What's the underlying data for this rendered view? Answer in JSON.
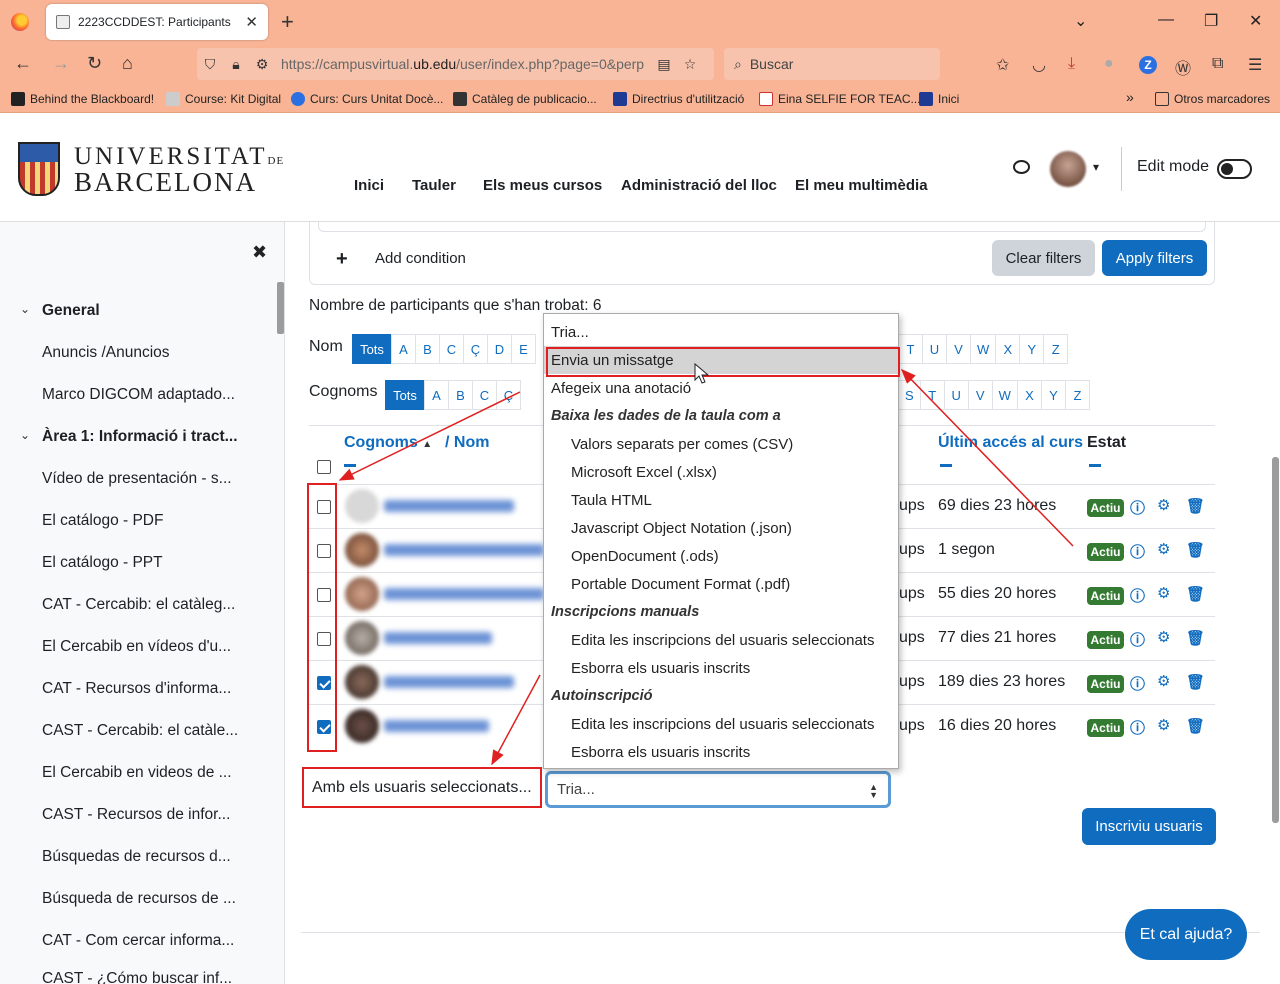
{
  "browser": {
    "tab_title": "2223CCDDEST: Participants",
    "url_prefix": "https://campusvirtual.",
    "url_domain": "ub.edu",
    "url_suffix": "/user/index.php?page=0&perp",
    "search_placeholder": "Buscar",
    "bookmarks": [
      "Behind the Blackboard!",
      "Course: Kit Digital",
      "Curs: Curs Unitat Docè...",
      "Catàleg de publicacio...",
      "Directrius d'utilització",
      "Eina SELFIE FOR TEAC...",
      "Inici"
    ],
    "other_bookmarks": "Otros marcadores"
  },
  "header": {
    "logo_line1": "UNIVERSITAT",
    "logo_de": "DE",
    "logo_line2": "BARCELONA",
    "nav": [
      "Inici",
      "Tauler",
      "Els meus cursos",
      "Administració del lloc",
      "El meu multimèdia"
    ],
    "edit_mode": "Edit mode"
  },
  "sidebar": {
    "items": [
      {
        "label": "General",
        "bold": true
      },
      {
        "label": "Anuncis /Anuncios"
      },
      {
        "label": "Marco DIGCOM adaptado..."
      },
      {
        "label": "Àrea 1: Informació i tract...",
        "bold": true
      },
      {
        "label": "Vídeo de presentación - s..."
      },
      {
        "label": "El catálogo - PDF"
      },
      {
        "label": "El catálogo - PPT"
      },
      {
        "label": "CAT - Cercabib: el catàleg..."
      },
      {
        "label": "El Cercabib en vídeos d'u..."
      },
      {
        "label": "CAT - Recursos d'informa..."
      },
      {
        "label": "CAST - Cercabib: el catàle..."
      },
      {
        "label": "El Cercabib en videos de ..."
      },
      {
        "label": "CAST - Recursos de infor..."
      },
      {
        "label": "Búsquedas de recursos d..."
      },
      {
        "label": "Búsqueda de recursos de ..."
      },
      {
        "label": "CAT - Com cercar informa..."
      },
      {
        "label": "CAST - ¿Cómo buscar inf..."
      }
    ]
  },
  "filters": {
    "add_condition": "Add condition",
    "clear": "Clear filters",
    "apply": "Apply filters"
  },
  "participants": {
    "found_text": "Nombre de participants que s'han trobat: 6",
    "name_label": "Nom",
    "surname_label": "Cognoms",
    "letters_first": [
      "Tots",
      "A",
      "B",
      "C",
      "Ç",
      "D",
      "E"
    ],
    "letters_last_nom": [
      "T",
      "U",
      "V",
      "W",
      "X",
      "Y",
      "Z"
    ],
    "letters_first_cog": [
      "Tots",
      "A",
      "B",
      "C",
      "Ç"
    ],
    "letters_last_cog": [
      "S",
      "T",
      "U",
      "V",
      "W",
      "X",
      "Y",
      "Z"
    ],
    "col_surname": "Cognoms",
    "col_name": "/ Nom",
    "col_last_access": "Últim accés al curs",
    "col_status": "Estat",
    "rows": [
      {
        "groups": "ups",
        "last_access": "69 dies 23 hores",
        "status": "Actiu",
        "checked": false
      },
      {
        "groups": "ups",
        "last_access": "1 segon",
        "status": "Actiu",
        "checked": false
      },
      {
        "groups": "ups",
        "last_access": "55 dies 20 hores",
        "status": "Actiu",
        "checked": false
      },
      {
        "groups": "ups",
        "last_access": "77 dies 21 hores",
        "status": "Actiu",
        "checked": false
      },
      {
        "groups": "ups",
        "last_access": "189 dies 23 hores",
        "status": "Actiu",
        "checked": true
      },
      {
        "groups": "ups",
        "last_access": "16 dies 20 hores",
        "status": "Actiu",
        "checked": true
      }
    ],
    "with_selected": "Amb els usuaris seleccionats...",
    "select_value": "Tria...",
    "enrol_button": "Inscriviu usuaris"
  },
  "dropdown": {
    "options": [
      {
        "label": "Tria...",
        "kind": "opt"
      },
      {
        "label": "Envia un missatge",
        "kind": "opt",
        "highlight": true
      },
      {
        "label": "Afegeix una anotació",
        "kind": "opt"
      },
      {
        "label": "Baixa les dades de la taula com a",
        "kind": "grp"
      },
      {
        "label": "Valors separats per comes (CSV)",
        "kind": "sub"
      },
      {
        "label": "Microsoft Excel (.xlsx)",
        "kind": "sub"
      },
      {
        "label": "Taula HTML",
        "kind": "sub"
      },
      {
        "label": "Javascript Object Notation (.json)",
        "kind": "sub"
      },
      {
        "label": "OpenDocument (.ods)",
        "kind": "sub"
      },
      {
        "label": "Portable Document Format (.pdf)",
        "kind": "sub"
      },
      {
        "label": "Inscripcions manuals",
        "kind": "grp"
      },
      {
        "label": "Edita les inscripcions del usuaris seleccionats",
        "kind": "sub"
      },
      {
        "label": "Esborra els usuaris inscrits",
        "kind": "sub"
      },
      {
        "label": "Autoinscripció",
        "kind": "grp"
      },
      {
        "label": "Edita les inscripcions del usuaris seleccionats",
        "kind": "sub"
      },
      {
        "label": "Esborra els usuaris inscrits",
        "kind": "sub"
      }
    ]
  },
  "help_button": "Et cal ajuda?",
  "colors": {
    "chrome": "#f9b496",
    "primary": "#0f6cbf",
    "active_badge": "#357a32",
    "annotation": "#e02020"
  }
}
